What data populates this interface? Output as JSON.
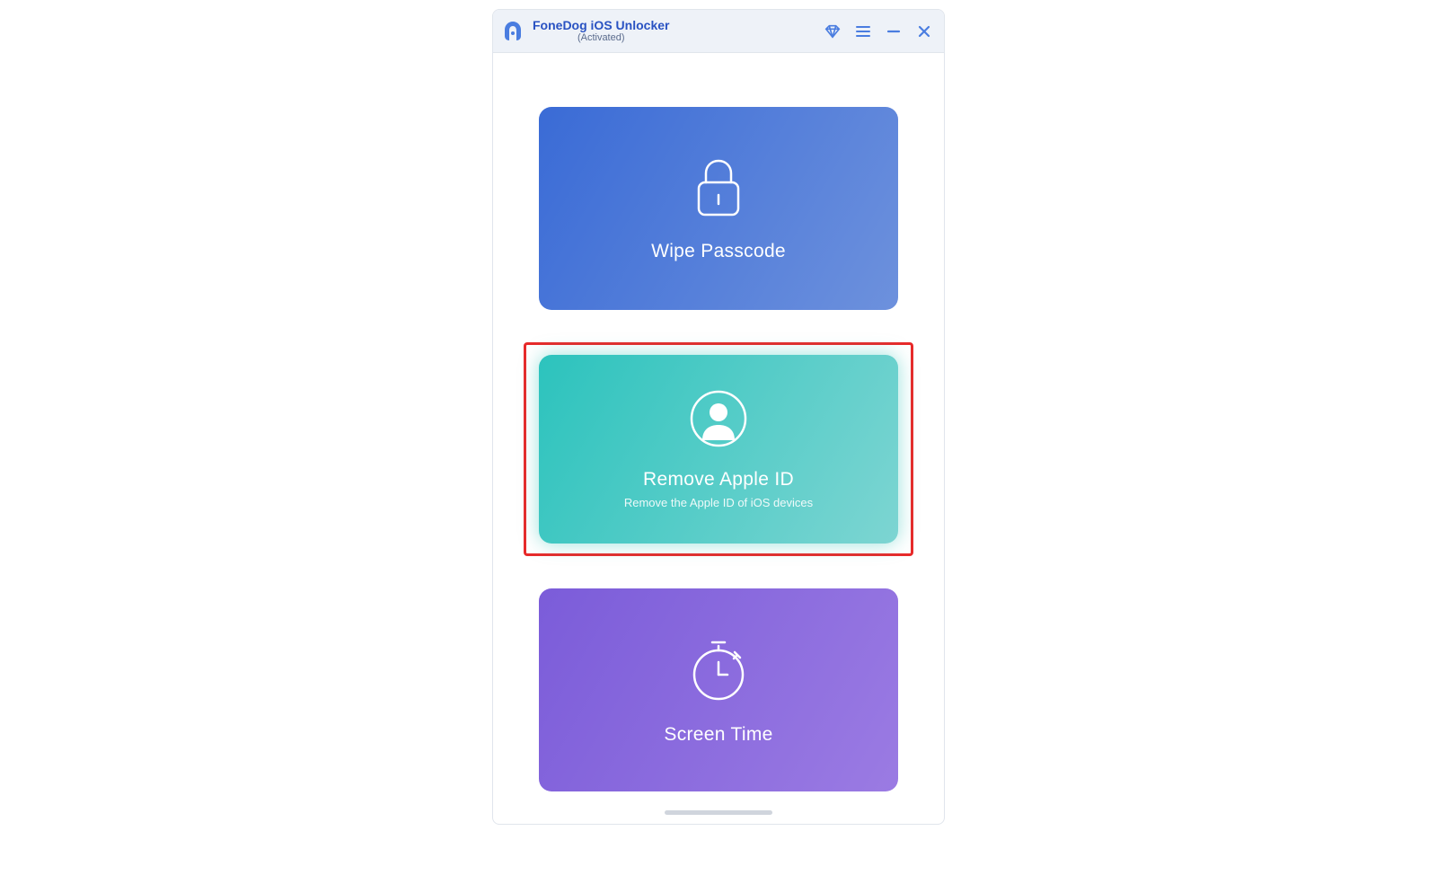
{
  "header": {
    "title": "FoneDog iOS Unlocker",
    "subtitle": "(Activated)"
  },
  "cards": {
    "wipe": {
      "title": "Wipe Passcode"
    },
    "apple_id": {
      "title": "Remove Apple ID",
      "subtitle": "Remove the Apple ID of iOS devices"
    },
    "screen_time": {
      "title": "Screen Time"
    }
  }
}
